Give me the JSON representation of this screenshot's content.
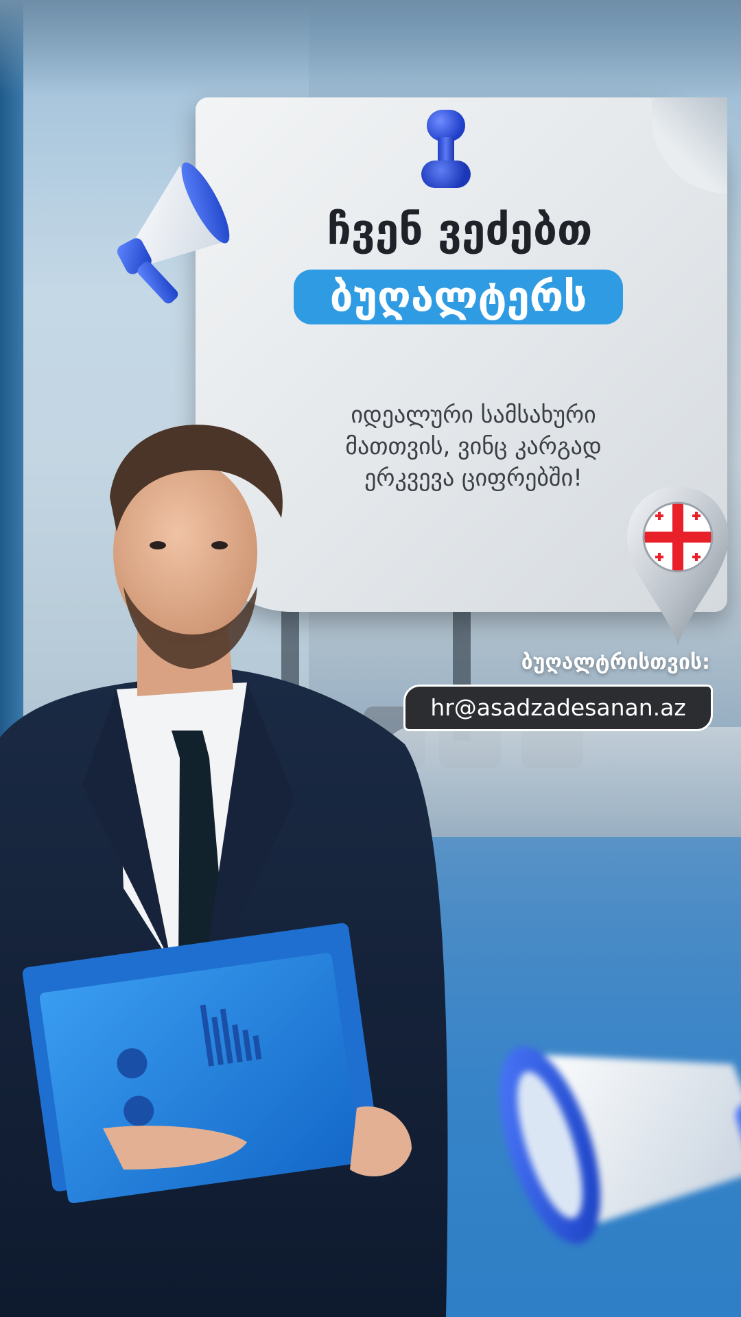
{
  "headline": {
    "line1": "ჩვენ ვეძებთ",
    "line2": "ბუღალტერს"
  },
  "subtitle": {
    "line1": "იდეალური სამსახური",
    "line2": "მათთვის, ვინც კარგად",
    "line3": "ერკვევა ციფრებში!"
  },
  "contact": {
    "label": "ბუღალტრისთვის:",
    "email": "hr@asadzadesanan.az"
  },
  "colors": {
    "accent_blue": "#2f9be3",
    "email_bg": "#2b2d31",
    "flag_red": "#e8202a"
  },
  "icons": [
    "megaphone-icon",
    "push-pin-icon",
    "location-pin-icon",
    "georgia-flag-icon"
  ]
}
